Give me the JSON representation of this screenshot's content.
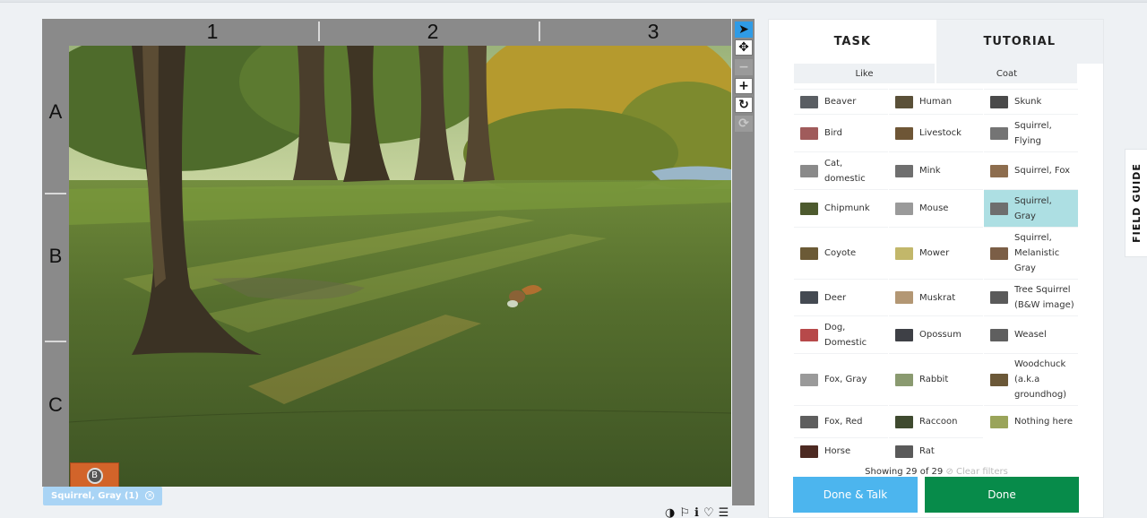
{
  "grid": {
    "columns": [
      "1",
      "2",
      "3"
    ],
    "rows": [
      "A",
      "B",
      "C"
    ]
  },
  "toolbar": {
    "tools": [
      {
        "name": "pointer-tool",
        "glyph": "➤",
        "icon": "cursor-arrow-icon",
        "state": "active"
      },
      {
        "name": "pan-tool",
        "glyph": "✥",
        "icon": "move-icon",
        "state": "normal"
      },
      {
        "name": "zoom-out-tool",
        "glyph": "−",
        "icon": "minus-icon",
        "state": "disabled"
      },
      {
        "name": "zoom-in-tool",
        "glyph": "+",
        "icon": "plus-icon",
        "state": "normal"
      },
      {
        "name": "rotate-tool",
        "glyph": "↻",
        "icon": "rotate-icon",
        "state": "normal"
      },
      {
        "name": "reset-tool",
        "glyph": "⟳",
        "icon": "reset-icon",
        "state": "disabled"
      }
    ]
  },
  "annotation_chip": {
    "label": "Squirrel, Gray (1)",
    "remove_icon": "close-circle-icon"
  },
  "meta_icons": [
    {
      "name": "invert-icon",
      "glyph": "◑"
    },
    {
      "name": "flag-icon",
      "glyph": "⚐"
    },
    {
      "name": "info-icon",
      "glyph": "ℹ"
    },
    {
      "name": "heart-icon",
      "glyph": "♡"
    },
    {
      "name": "collections-icon",
      "glyph": "☰"
    }
  ],
  "tabs": {
    "task": "TASK",
    "tutorial": "TUTORIAL"
  },
  "filters": {
    "like": "Like",
    "coat": "Coat"
  },
  "species": [
    [
      {
        "label": "Beaver",
        "color": "#5a5e63"
      },
      {
        "label": "Bird",
        "color": "#a05b5b"
      },
      {
        "label": "Cat, domestic",
        "color": "#8a8a8a"
      },
      {
        "label": "Chipmunk",
        "color": "#4d5a2e"
      },
      {
        "label": "Coyote",
        "color": "#6b5a36"
      },
      {
        "label": "Deer",
        "color": "#444a52"
      },
      {
        "label": "Dog, Domestic",
        "color": "#b7494a"
      },
      {
        "label": "Fox, Gray",
        "color": "#9a9a9a"
      },
      {
        "label": "Fox, Red",
        "color": "#5e5e5e"
      },
      {
        "label": "Horse",
        "color": "#4d2a22"
      }
    ],
    [
      {
        "label": "Human",
        "color": "#5a5038"
      },
      {
        "label": "Livestock",
        "color": "#6e5636"
      },
      {
        "label": "Mink",
        "color": "#6f6f6f"
      },
      {
        "label": "Mouse",
        "color": "#9a9a9a"
      },
      {
        "label": "Mower",
        "color": "#c2b76a"
      },
      {
        "label": "Muskrat",
        "color": "#b39774"
      },
      {
        "label": "Opossum",
        "color": "#3e4046"
      },
      {
        "label": "Rabbit",
        "color": "#8a9a70"
      },
      {
        "label": "Raccoon",
        "color": "#3f4a2f"
      },
      {
        "label": "Rat",
        "color": "#5a5a5a"
      }
    ],
    [
      {
        "label": "Skunk",
        "color": "#4a4a4a"
      },
      {
        "label": "Squirrel, Flying",
        "color": "#747474"
      },
      {
        "label": "Squirrel, Fox",
        "color": "#8d6d4e"
      },
      {
        "label": "Squirrel, Gray",
        "color": "#6e6e6e",
        "selected": true
      },
      {
        "label": "Squirrel, Melanistic Gray",
        "color": "#7b5e46"
      },
      {
        "label": "Tree Squirrel (B&W image)",
        "color": "#5a5a5a"
      },
      {
        "label": "Weasel",
        "color": "#5f5f5f"
      },
      {
        "label": "Woodchuck (a.k.a groundhog)",
        "color": "#6b5838"
      },
      {
        "label": "Nothing here",
        "color": "#9aa45a"
      }
    ]
  ],
  "showing": {
    "text": "Showing 29 of 29",
    "clear": "⊘ Clear filters"
  },
  "buttons": {
    "done_talk": "Done & Talk",
    "done": "Done"
  },
  "field_guide": "FIELD GUIDE"
}
